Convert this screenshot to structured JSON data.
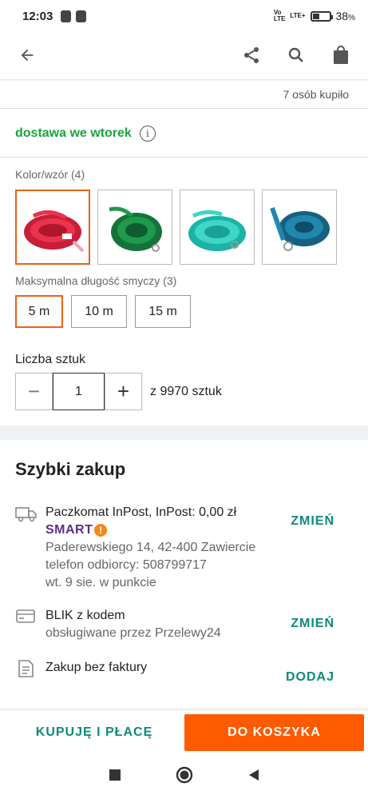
{
  "status_bar": {
    "time": "12:03",
    "battery": "38",
    "battery_unit": "%",
    "network": "LTE+"
  },
  "header": {
    "back_icon": "arrow-left-icon",
    "share_icon": "share-icon",
    "search_icon": "search-icon",
    "bag_icon": "shopping-bag-icon"
  },
  "bought_text": "7 osób kupiło",
  "delivery": {
    "text": "dostawa we wtorek",
    "info": "i"
  },
  "color": {
    "label": "Kolor/wzór (4)",
    "selected_index": 0,
    "options": [
      {
        "name": "red-leash",
        "color": "#d9263f"
      },
      {
        "name": "green-leash",
        "color": "#1f8a3c"
      },
      {
        "name": "turquoise-leash",
        "color": "#2cc7b8"
      },
      {
        "name": "blue-leash",
        "color": "#1f6f91"
      }
    ]
  },
  "length": {
    "label": "Maksymalna długość smyczy (3)",
    "options": [
      "5 m",
      "10 m",
      "15 m"
    ],
    "selected_index": 0
  },
  "quantity": {
    "label": "Liczba sztuk",
    "minus": "−",
    "value": "1",
    "plus": "+",
    "stock": "z 9970 sztuk"
  },
  "quick": {
    "title": "Szybki zakup",
    "shipping": {
      "title": "Paczkomat InPost, InPost: 0,00 zł",
      "smart": "SMART",
      "smart_bang": "!",
      "address": "Paderewskiego 14, 42-400 Zawiercie",
      "phone": "telefon odbiorcy: 508799717",
      "date": "wt. 9 sie. w punkcie",
      "action": "ZMIEŃ"
    },
    "payment": {
      "title": "BLIK z kodem",
      "sub": "obsługiwane przez Przelewy24",
      "action": "ZMIEŃ"
    },
    "invoice": {
      "title": "Zakup bez faktury",
      "action": "DODAJ"
    }
  },
  "bottom": {
    "buy_now": "KUPUJĘ I PŁACĘ",
    "add_to_cart": "DO KOSZYKA"
  },
  "colors": {
    "accent": "#ff5a00",
    "teal": "#0d8a7a",
    "green": "#19a33d"
  }
}
